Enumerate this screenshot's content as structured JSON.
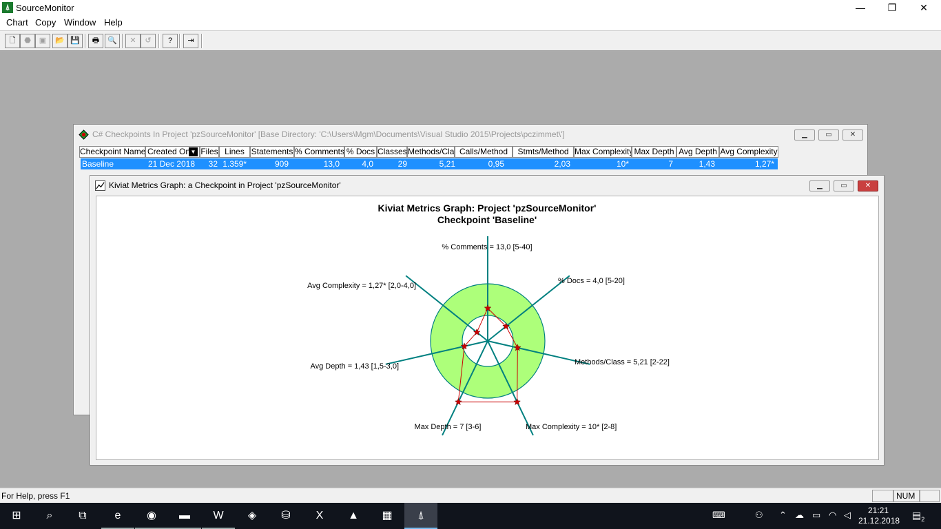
{
  "app": {
    "title": "SourceMonitor"
  },
  "window_controls": {
    "minimize": "—",
    "maximize": "❐",
    "close": "✕"
  },
  "menu": [
    "Chart",
    "Copy",
    "Window",
    "Help"
  ],
  "toolbar": [
    {
      "name": "new-icon",
      "glyph": "🗋",
      "enabled": true
    },
    {
      "name": "stop-icon",
      "glyph": "⬣",
      "enabled": false
    },
    {
      "name": "stack-icon",
      "glyph": "▣",
      "enabled": false
    },
    {
      "name": "open-folder-icon",
      "glyph": "📂",
      "enabled": true
    },
    {
      "name": "save-icon",
      "glyph": "💾",
      "enabled": true
    },
    {
      "name": "print-icon",
      "glyph": "🖶",
      "enabled": true
    },
    {
      "name": "print-preview-icon",
      "glyph": "🔍",
      "enabled": true
    },
    {
      "name": "delete-icon",
      "glyph": "✕",
      "enabled": false
    },
    {
      "name": "undo-icon",
      "glyph": "↺",
      "enabled": false
    },
    {
      "name": "context-help-icon",
      "glyph": "?",
      "enabled": true
    },
    {
      "name": "exit-icon",
      "glyph": "⇥",
      "enabled": true
    }
  ],
  "checkpoints_window": {
    "title": "C# Checkpoints In Project 'pzSourceMonitor'  [Base Directory: 'C:\\Users\\Mgm\\Documents\\Visual Studio 2015\\Projects\\pczimmet\\']",
    "columns": [
      "Checkpoint Name",
      "Created On",
      "Files",
      "Lines",
      "Statements",
      "% Comments",
      "% Docs",
      "Classes",
      "Methods/Class",
      "Calls/Method",
      "Stmts/Method",
      "Max Complexity",
      "Max Depth",
      "Avg Depth",
      "Avg Complexity"
    ],
    "sort_indicator": "▼",
    "rows": [
      [
        "Baseline",
        "21 Dec 2018",
        "32",
        "1.359*",
        "909",
        "13,0",
        "4,0",
        "29",
        "5,21",
        "0,95",
        "2,03",
        "10*",
        "7",
        "1,43",
        "1,27*"
      ]
    ]
  },
  "graph_window": {
    "title": "Kiviat Metrics Graph: a Checkpoint in Project 'pzSourceMonitor'",
    "heading_line1": "Kiviat Metrics Graph: Project 'pzSourceMonitor'",
    "heading_line2": "Checkpoint 'Baseline'"
  },
  "chart_data": {
    "type": "radar",
    "title": "Kiviat Metrics Graph: Project 'pzSourceMonitor' Checkpoint 'Baseline'",
    "axes": [
      {
        "label": "% Comments = 13,0 [5-40]",
        "value": 13.0,
        "range": [
          5,
          40
        ]
      },
      {
        "label": "% Docs = 4,0 [5-20]",
        "value": 4.0,
        "range": [
          5,
          20
        ]
      },
      {
        "label": "Methods/Class = 5,21 [2-22]",
        "value": 5.21,
        "range": [
          2,
          22
        ]
      },
      {
        "label": "Max Complexity = 10* [2-8]",
        "value": 10,
        "range": [
          2,
          8
        ]
      },
      {
        "label": "Max Depth = 7 [3-6]",
        "value": 7,
        "range": [
          3,
          6
        ]
      },
      {
        "label": "Avg Depth = 1,43 [1,5-3,0]",
        "value": 1.43,
        "range": [
          1.5,
          3.0
        ]
      },
      {
        "label": "Avg Complexity = 1,27* [2,0-4,0]",
        "value": 1.27,
        "range": [
          2.0,
          4.0
        ]
      }
    ],
    "colors": {
      "band": "#adff7a",
      "axis": "#008080",
      "polygon": "#cc0000",
      "marker": "#cc0000"
    }
  },
  "status": {
    "help": "For Help, press F1",
    "num": "NUM"
  },
  "taskbar": {
    "apps": [
      {
        "name": "start-icon",
        "glyph": "⊞"
      },
      {
        "name": "search-icon",
        "glyph": "⌕"
      },
      {
        "name": "task-view-icon",
        "glyph": "⧉"
      },
      {
        "name": "edge-icon",
        "glyph": "e"
      },
      {
        "name": "chrome-icon",
        "glyph": "◉"
      },
      {
        "name": "file-explorer-icon",
        "glyph": "▬"
      },
      {
        "name": "word-icon",
        "glyph": "W"
      },
      {
        "name": "visual-studio-icon",
        "glyph": "◈"
      },
      {
        "name": "database-tool-icon",
        "glyph": "⛁"
      },
      {
        "name": "excel-icon",
        "glyph": "X"
      },
      {
        "name": "photos-icon",
        "glyph": "▲"
      },
      {
        "name": "winrar-icon",
        "glyph": "▦"
      },
      {
        "name": "sourcemonitor-icon",
        "glyph": "⍋"
      }
    ],
    "time": "21:21",
    "date": "21.12.2018",
    "notifications": "2"
  }
}
